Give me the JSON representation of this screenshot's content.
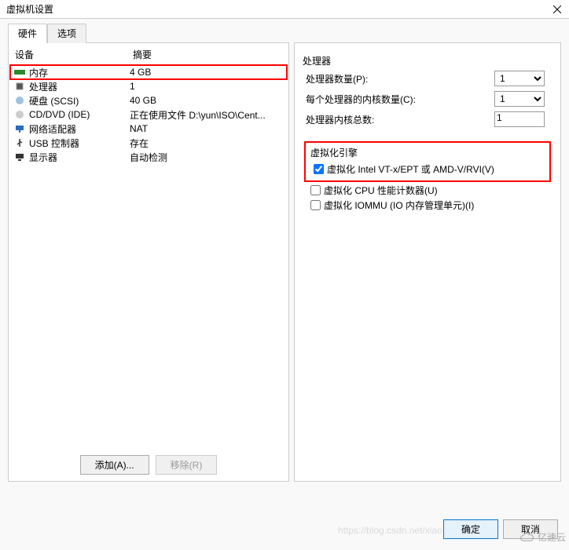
{
  "window": {
    "title": "虚拟机设置"
  },
  "tabs": {
    "hardware": "硬件",
    "options": "选项"
  },
  "list": {
    "header_device": "设备",
    "header_summary": "摘要",
    "rows": [
      {
        "icon": "memory-icon",
        "name": "内存",
        "summary": "4 GB",
        "highlighted": true
      },
      {
        "icon": "cpu-icon",
        "name": "处理器",
        "summary": "1"
      },
      {
        "icon": "disk-icon",
        "name": "硬盘 (SCSI)",
        "summary": "40 GB"
      },
      {
        "icon": "cd-icon",
        "name": "CD/DVD (IDE)",
        "summary": "正在使用文件 D:\\yun\\ISO\\Cent..."
      },
      {
        "icon": "network-icon",
        "name": "网络适配器",
        "summary": "NAT"
      },
      {
        "icon": "usb-icon",
        "name": "USB 控制器",
        "summary": "存在"
      },
      {
        "icon": "display-icon",
        "name": "显示器",
        "summary": "自动检测"
      }
    ]
  },
  "buttons": {
    "add": "添加(A)...",
    "remove": "移除(R)",
    "ok": "确定",
    "cancel": "取消"
  },
  "processor": {
    "group_title": "处理器",
    "num_proc_label": "处理器数量(P):",
    "num_proc_value": "1",
    "cores_label": "每个处理器的内核数量(C):",
    "cores_value": "1",
    "total_label": "处理器内核总数:",
    "total_value": "1"
  },
  "virtualization": {
    "group_title": "虚拟化引擎",
    "opt_vt": "虚拟化 Intel VT-x/EPT 或 AMD-V/RVI(V)",
    "opt_vt_checked": true,
    "opt_counters": "虚拟化 CPU 性能计数器(U)",
    "opt_counters_checked": false,
    "opt_iommu": "虚拟化 IOMMU (IO 内存管理单元)(I)",
    "opt_iommu_checked": false
  },
  "watermark": {
    "url": "https://blog.csdn.net/xiao",
    "brand": "亿速云"
  }
}
